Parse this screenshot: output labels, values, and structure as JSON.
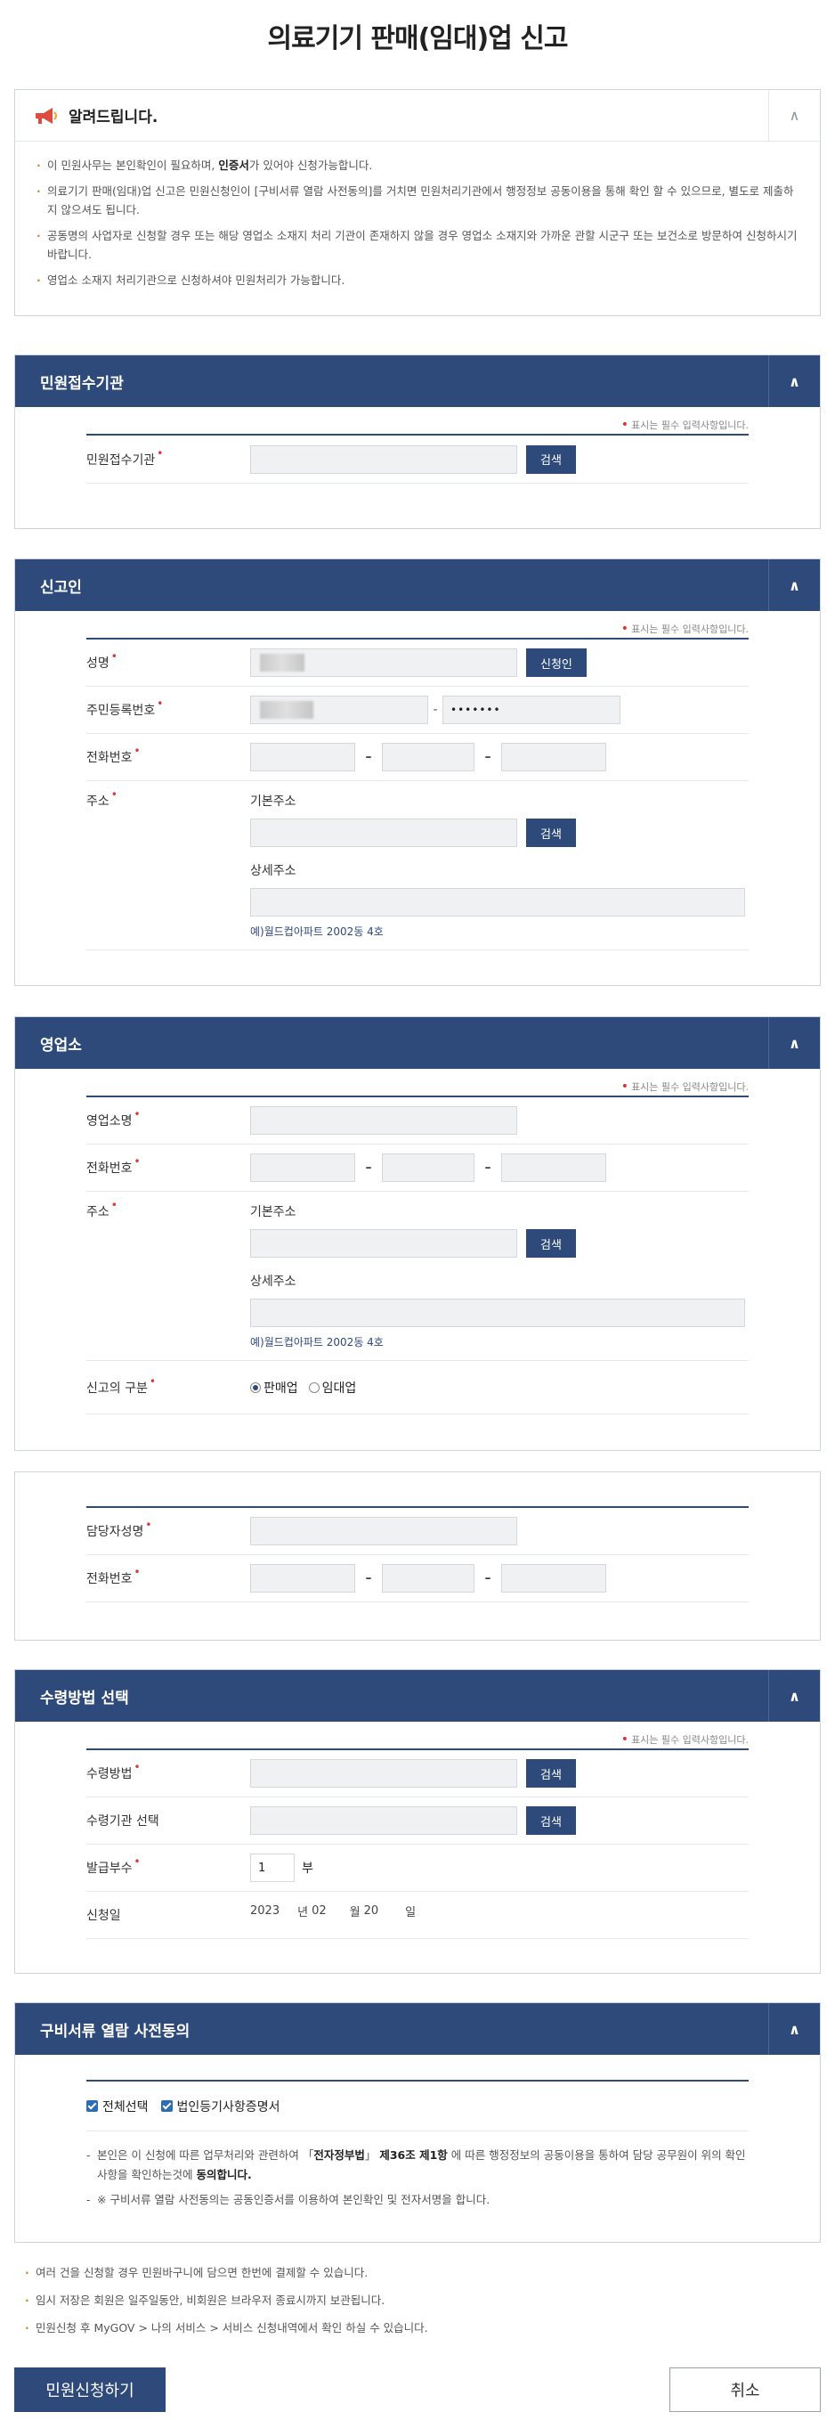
{
  "page_title": "의료기기 판매(임대)업 신고",
  "notice": {
    "title": "알려드립니다.",
    "items": [
      {
        "pre": "이 민원사무는 본인확인이 필요하며, ",
        "bold": "인증서",
        "post": "가 있어야 신청가능합니다."
      },
      {
        "pre": "의료기기 판매(임대)업 신고은 민원신청인이 [구비서류 열람 사전동의]를 거치면 민원처리기관에서 행정정보 공동이용을 통해 확인 할 수 있으므로, 별도로 제출하지 않으셔도 됩니다.",
        "bold": "",
        "post": ""
      },
      {
        "pre": "공동명의 사업자로 신청할 경우 또는 해당 영업소 소재지 처리 기관이 존재하지 않을 경우 영업소 소재지와 가까운 관할 시군구 또는 보건소로 방문하여 신청하시기 바랍니다.",
        "bold": "",
        "post": ""
      },
      {
        "pre": "영업소 소재지 처리기관으로 신청하셔야 민원처리가 가능합니다.",
        "bold": "",
        "post": ""
      }
    ]
  },
  "required_note": "표시는 필수 입력사항입니다.",
  "search_label": "검색",
  "sections": {
    "agency": {
      "title": "민원접수기관",
      "label": "민원접수기관"
    },
    "applicant": {
      "title": "신고인",
      "name_label": "성명",
      "name_button": "신청인",
      "rrn_label": "주민등록번호",
      "rrn_back": "•••••••",
      "phone_label": "전화번호",
      "address_label": "주소",
      "basic_address": "기본주소",
      "detail_address": "상세주소",
      "detail_hint": "예)월드컵아파트 2002동 4호"
    },
    "office": {
      "title": "영업소",
      "name_label": "영업소명",
      "phone_label": "전화번호",
      "address_label": "주소",
      "basic_address": "기본주소",
      "detail_address": "상세주소",
      "detail_hint": "예)월드컵아파트 2002동 4호",
      "type_label": "신고의 구분",
      "type_options": [
        "판매업",
        "임대업"
      ],
      "type_selected": "판매업"
    },
    "contact": {
      "name_label": "담당자성명",
      "phone_label": "전화번호"
    },
    "receive": {
      "title": "수령방법 선택",
      "method_label": "수령방법",
      "agency_label": "수령기관 선택",
      "copies_label": "발급부수",
      "copies_value": "1",
      "copies_unit": "부",
      "date_label": "신청일",
      "year": "2023",
      "year_unit": "년",
      "month": "02",
      "month_unit": "월",
      "day": "20",
      "day_unit": "일"
    },
    "consent": {
      "title": "구비서류 열람 사전동의",
      "check_all": "전체선택",
      "check_doc": "법인등기사항증명서",
      "text1_pre": "본인은 이 신청에 따른 업무처리와 관련하여 「",
      "text1_law": "전자정부법",
      "text1_mid": "」 ",
      "text1_art": "제36조 제1항",
      "text1_post": " 에 따른 행정정보의 공동이용을 통하여 담당 공무원이 위의 확인 사항을 확인하는것에 ",
      "text1_agree": "동의합니다.",
      "text2": "※ 구비서류 열람 사전동의는 공동인증서를 이용하여 본인확인 및 전자서명을 합니다."
    }
  },
  "bottom_notes": [
    "여러 건을 신청할 경우 민원바구니에 담으면 한번에 결제할 수 있습니다.",
    "임시 저장은 회원은 일주일동안, 비회원은 브라우저 종료시까지 보관됩니다.",
    "민원신청 후 MyGOV > 나의 서비스 > 서비스 신청내역에서 확인 하실 수 있습니다."
  ],
  "buttons": {
    "apply": "민원신청하기",
    "cancel": "취소"
  }
}
